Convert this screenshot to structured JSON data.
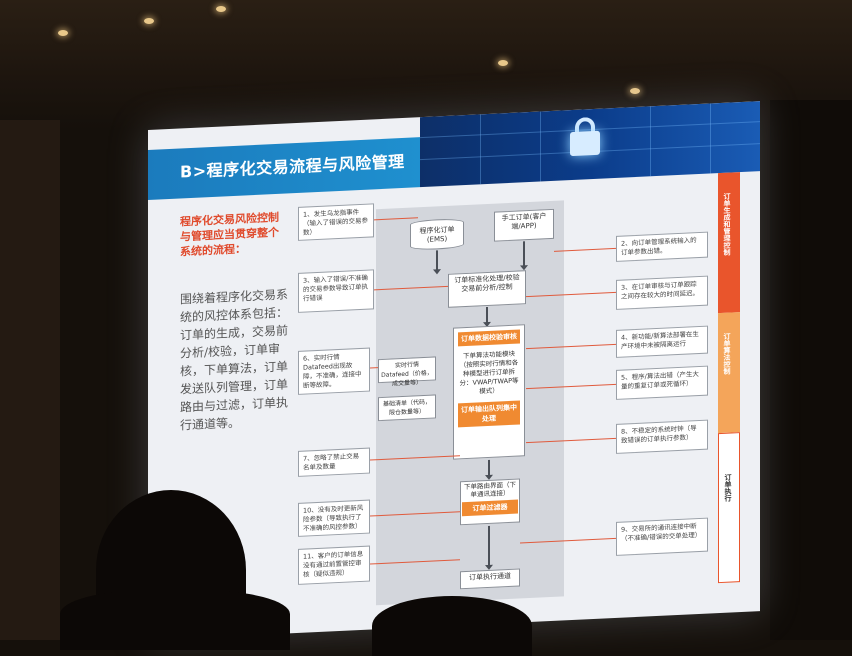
{
  "slide": {
    "title": "B>程序化交易流程与风险管理",
    "intro_heading": "程序化交易风险控制与管理应当贯穿整个系统的流程：",
    "intro_body": "围绕着程序化交易系统的风控体系包括：订单的生成，交易前分析/校验，订单审核，下单算法，订单发送队列管理，订单路由与过滤，订单执行通道等。",
    "flow": {
      "ems": "程序化订单(EMS)",
      "manual": "手工订单(客户端/APP)",
      "standardize": "订单标准化处理/校验交易前分析/控制",
      "verify": "订单数据校验审核",
      "algo": "下单算法功能模块（按照实时行情和各种模型进行订单拆分：VWAP/TWAP等模式）",
      "queue": "订单输出队列集中处理",
      "realtime_feed": "实时行情 Datafeed（价格，成交量等）",
      "basic_list": "基础清单（代码，限仓数量等）",
      "routing": "下单路由界面（下单通讯连接）",
      "filter": "订单过滤器",
      "channel": "订单执行通道"
    },
    "notes_left": [
      "1、发生乌龙指事件（输入了错误的交易参数）",
      "3、输入了错误/不准确的交易参数导致订单执行错误",
      "6、实时行情Datafeed出现故障，不准确，连接中断等故障。",
      "7、忽略了禁止交易名单及数量",
      "10、没有及时更新风险参数（导致执行了不准确的风控参数）",
      "11、客户的订单信息没有通过前置管控审核（疑似违规）"
    ],
    "notes_right": [
      "2、向订单管理系统输入的订单参数出错。",
      "3、在订单审核与订单跟踪之间存在较大的时间延迟。",
      "4、新功能/新算法部署在生产环境中未被隔离运行",
      "5、程序/算法出错（产生大量的重复订单或死循环）",
      "8、不稳定的系统时钟（导致错误的订单执行参数）",
      "9、交易所的通讯连接中断（不准确/错误的交单处理）"
    ],
    "side_labels": [
      "订单生成和管理控制",
      "订单算法控制",
      "订单执行"
    ],
    "colors": {
      "accent_orange": "#f08a31",
      "accent_red": "#e04a2c",
      "title_blue": "#1b7bbd"
    }
  }
}
